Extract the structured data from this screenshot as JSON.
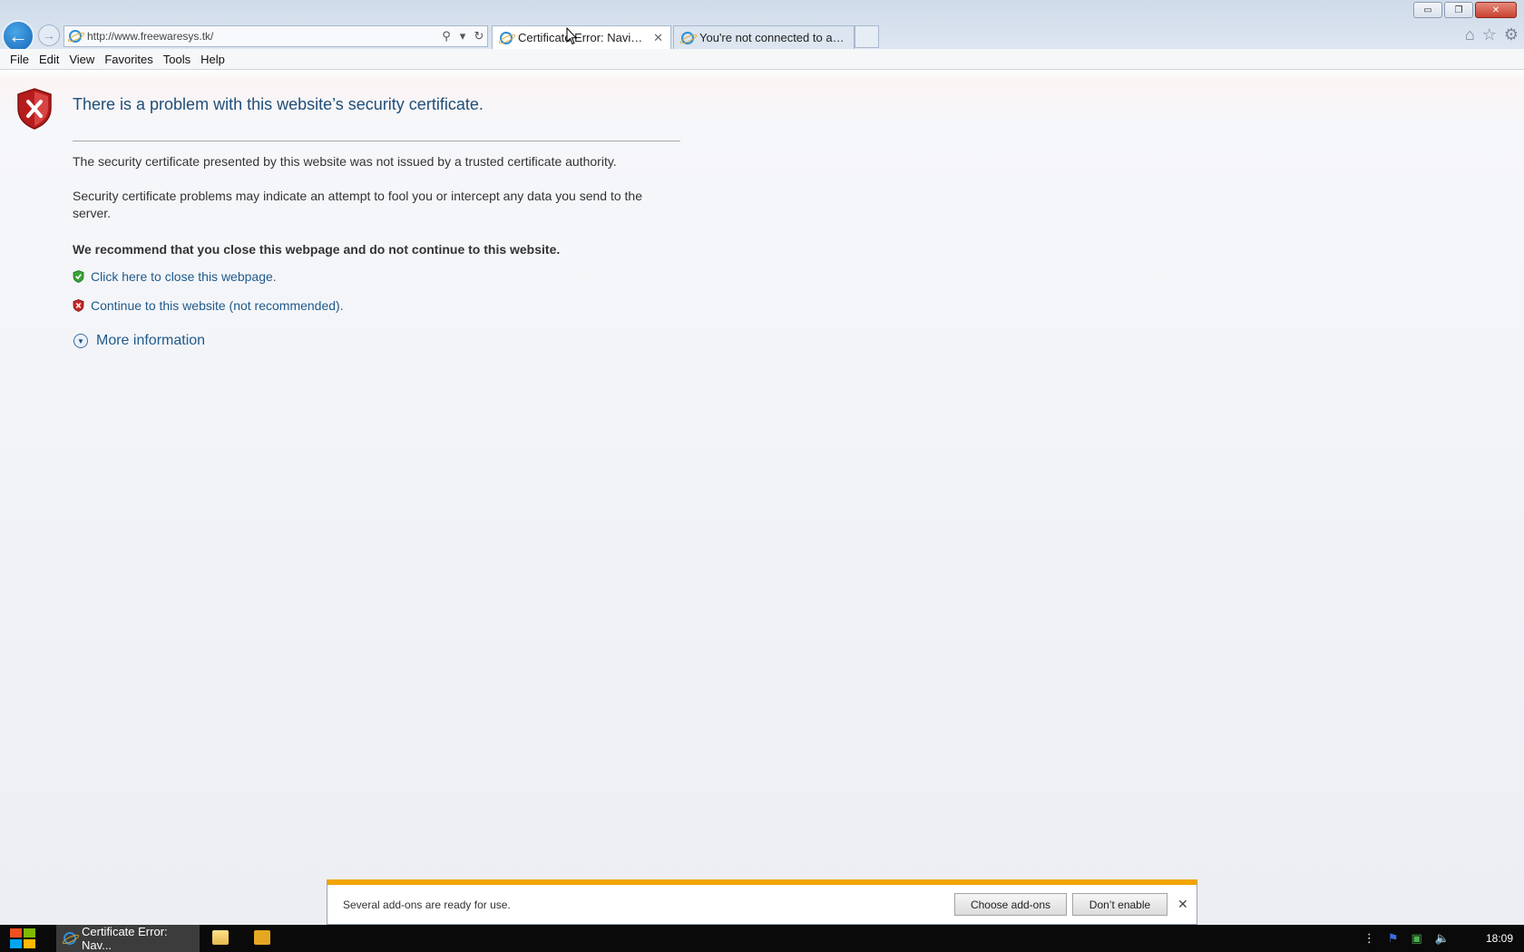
{
  "window": {
    "minimize_label": "▭",
    "restore_label": "❐",
    "close_label": "✕"
  },
  "address": {
    "url": "http://www.freewaresys.tk/",
    "search_glyph": "⚲",
    "refresh_glyph": "↻"
  },
  "tabs": [
    {
      "title": "Certificate Error: Navigatio...",
      "close_glyph": "✕"
    },
    {
      "title": "You're not connected to a net..."
    }
  ],
  "toolbar_icons": {
    "home_glyph": "⌂",
    "favorites_glyph": "☆",
    "settings_glyph": "⚙"
  },
  "menu": {
    "items": [
      "File",
      "Edit",
      "View",
      "Favorites",
      "Tools",
      "Help"
    ]
  },
  "page": {
    "title": "There is a problem with this website’s security certificate.",
    "para1": "The security certificate presented by this website was not issued by a trusted certificate authority.",
    "para2": "Security certificate problems may indicate an attempt to fool you or intercept any data you send to the server.",
    "recommendation": "We recommend that you close this webpage and do not continue to this website.",
    "close_link": "Click here to close this webpage.",
    "continue_link": "Continue to this website (not recommended).",
    "more_info": "More information"
  },
  "notification": {
    "text": "Several add-ons are ready for use.",
    "choose_button": "Choose add-ons",
    "dont_button": "Don’t enable",
    "close_glyph": "✕"
  },
  "taskbar": {
    "active_task": "Certificate Error: Nav...",
    "clock": "18:09"
  },
  "colors": {
    "accent_blue": "#1f5a8c",
    "warning_orange": "#f2a400",
    "error_red": "#c62828",
    "safe_green": "#3aa33a"
  }
}
